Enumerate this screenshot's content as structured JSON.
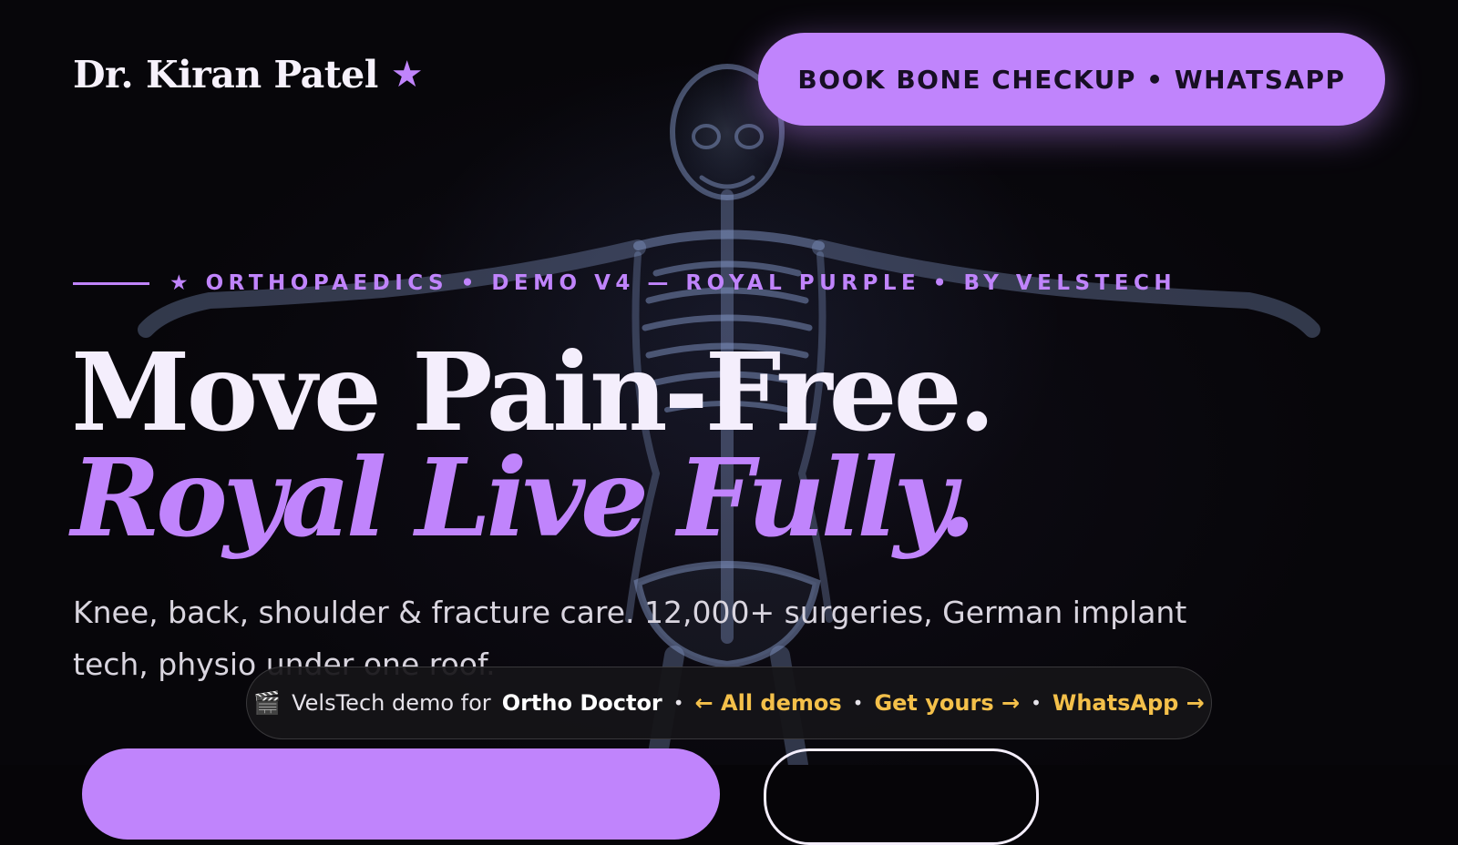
{
  "header": {
    "brand_name": "Dr. Kiran Patel",
    "brand_star": "★",
    "cta_label": "BOOK BONE CHECKUP • WHATSAPP"
  },
  "hero": {
    "eyebrow": "★ ORTHOPAEDICS • DEMO V4 — ROYAL PURPLE • BY VELSTECH",
    "headline_line1": "Move Pain-Free.",
    "headline_line2": "Royal Live Fully.",
    "description": "Knee, back, shoulder & fracture care. 12,000+ surgeries, German implant tech, physio under one roof."
  },
  "demo_bar": {
    "clapper_icon": "🎬",
    "prefix": "VelsTech demo for",
    "subject": "Ortho Doctor",
    "separator": "•",
    "link_all_demos": "← All demos",
    "link_get_yours": "Get yours →",
    "link_whatsapp": "WhatsApp →"
  },
  "colors": {
    "accent": "#c084fc",
    "background": "#07060a",
    "link_gold": "#f4c04a",
    "text_light": "#f4eefc"
  }
}
